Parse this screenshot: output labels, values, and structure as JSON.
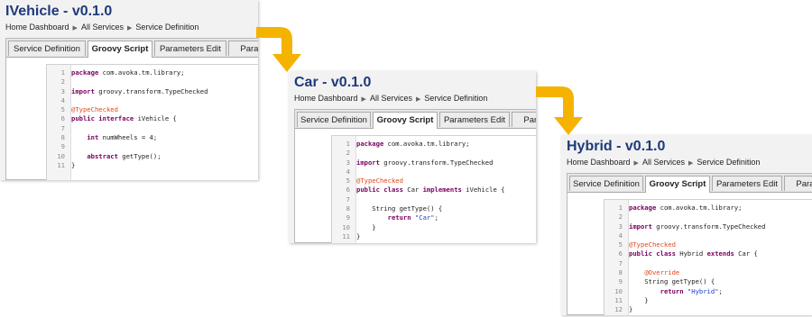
{
  "colors": {
    "title": "#1f3a7a",
    "arrow": "#f5b300",
    "keyword": "#7a0060",
    "annotation": "#e0491b",
    "string": "#1a3fc4"
  },
  "panels": [
    {
      "title": "IVehicle - v0.1.0",
      "breadcrumb": [
        "Home Dashboard",
        "All Services",
        "Service Definition"
      ],
      "tabs": [
        "Service Definition",
        "Groovy Script",
        "Parameters Edit",
        "Parame"
      ],
      "active_tab": "Groovy Script",
      "code": [
        {
          "n": "1",
          "segs": [
            {
              "t": "package",
              "c": "kw"
            },
            {
              "t": " com.avoka.tm.library;",
              "c": ""
            }
          ]
        },
        {
          "n": "2",
          "segs": []
        },
        {
          "n": "3",
          "segs": [
            {
              "t": "import",
              "c": "kw"
            },
            {
              "t": " groovy.transform.TypeChecked",
              "c": ""
            }
          ]
        },
        {
          "n": "4",
          "segs": []
        },
        {
          "n": "5",
          "segs": [
            {
              "t": "@TypeChecked",
              "c": "ann"
            }
          ]
        },
        {
          "n": "6",
          "segs": [
            {
              "t": "public interface",
              "c": "kw"
            },
            {
              "t": " iVehicle {",
              "c": ""
            }
          ]
        },
        {
          "n": "7",
          "segs": []
        },
        {
          "n": "8",
          "segs": [
            {
              "t": "    ",
              "c": ""
            },
            {
              "t": "int",
              "c": "kw"
            },
            {
              "t": " numWheels = 4;",
              "c": ""
            }
          ]
        },
        {
          "n": "9",
          "segs": []
        },
        {
          "n": "10",
          "segs": [
            {
              "t": "    ",
              "c": ""
            },
            {
              "t": "abstract",
              "c": "kw"
            },
            {
              "t": " getType();",
              "c": ""
            }
          ]
        },
        {
          "n": "11",
          "segs": [
            {
              "t": "}",
              "c": ""
            }
          ]
        }
      ]
    },
    {
      "title": "Car - v0.1.0",
      "breadcrumb": [
        "Home Dashboard",
        "All Services",
        "Service Definition"
      ],
      "tabs": [
        "Service Definition",
        "Groovy Script",
        "Parameters Edit",
        "Parame"
      ],
      "active_tab": "Groovy Script",
      "code": [
        {
          "n": "1",
          "segs": [
            {
              "t": "package",
              "c": "kw"
            },
            {
              "t": " com.avoka.tm.library;",
              "c": ""
            }
          ]
        },
        {
          "n": "2",
          "segs": []
        },
        {
          "n": "3",
          "segs": [
            {
              "t": "import",
              "c": "kw"
            },
            {
              "t": " groovy.transform.TypeChecked",
              "c": ""
            }
          ]
        },
        {
          "n": "4",
          "segs": []
        },
        {
          "n": "5",
          "segs": [
            {
              "t": "@TypeChecked",
              "c": "ann"
            }
          ]
        },
        {
          "n": "6",
          "segs": [
            {
              "t": "public class",
              "c": "kw"
            },
            {
              "t": " Car ",
              "c": ""
            },
            {
              "t": "implements",
              "c": "kw"
            },
            {
              "t": " iVehicle {",
              "c": ""
            }
          ]
        },
        {
          "n": "7",
          "segs": []
        },
        {
          "n": "8",
          "segs": [
            {
              "t": "    String getType() {",
              "c": ""
            }
          ]
        },
        {
          "n": "9",
          "segs": [
            {
              "t": "        ",
              "c": ""
            },
            {
              "t": "return",
              "c": "kw"
            },
            {
              "t": " ",
              "c": ""
            },
            {
              "t": "\"Car\"",
              "c": "str"
            },
            {
              "t": ";",
              "c": ""
            }
          ]
        },
        {
          "n": "10",
          "segs": [
            {
              "t": "    }",
              "c": ""
            }
          ]
        },
        {
          "n": "11",
          "segs": [
            {
              "t": "}",
              "c": ""
            }
          ]
        }
      ]
    },
    {
      "title": "Hybrid - v0.1.0",
      "breadcrumb": [
        "Home Dashboard",
        "All Services",
        "Service Definition"
      ],
      "tabs": [
        "Service Definition",
        "Groovy Script",
        "Parameters Edit",
        "Parame"
      ],
      "active_tab": "Groovy Script",
      "code": [
        {
          "n": "1",
          "segs": [
            {
              "t": "package",
              "c": "kw"
            },
            {
              "t": " com.avoka.tm.library;",
              "c": ""
            }
          ]
        },
        {
          "n": "2",
          "segs": []
        },
        {
          "n": "3",
          "segs": [
            {
              "t": "import",
              "c": "kw"
            },
            {
              "t": " groovy.transform.TypeChecked",
              "c": ""
            }
          ]
        },
        {
          "n": "4",
          "segs": []
        },
        {
          "n": "5",
          "segs": [
            {
              "t": "@TypeChecked",
              "c": "ann"
            }
          ]
        },
        {
          "n": "6",
          "segs": [
            {
              "t": "public class",
              "c": "kw"
            },
            {
              "t": " Hybrid ",
              "c": ""
            },
            {
              "t": "extends",
              "c": "kw"
            },
            {
              "t": " Car {",
              "c": ""
            }
          ]
        },
        {
          "n": "7",
          "segs": []
        },
        {
          "n": "8",
          "segs": [
            {
              "t": "    ",
              "c": ""
            },
            {
              "t": "@Override",
              "c": "ann"
            }
          ]
        },
        {
          "n": "9",
          "segs": [
            {
              "t": "    String getType() {",
              "c": ""
            }
          ]
        },
        {
          "n": "10",
          "segs": [
            {
              "t": "        ",
              "c": ""
            },
            {
              "t": "return",
              "c": "kw"
            },
            {
              "t": " ",
              "c": ""
            },
            {
              "t": "\"Hybrid\"",
              "c": "str"
            },
            {
              "t": ";",
              "c": ""
            }
          ]
        },
        {
          "n": "11",
          "segs": [
            {
              "t": "    }",
              "c": ""
            }
          ]
        },
        {
          "n": "12",
          "segs": [
            {
              "t": "}",
              "c": ""
            }
          ]
        }
      ]
    }
  ]
}
